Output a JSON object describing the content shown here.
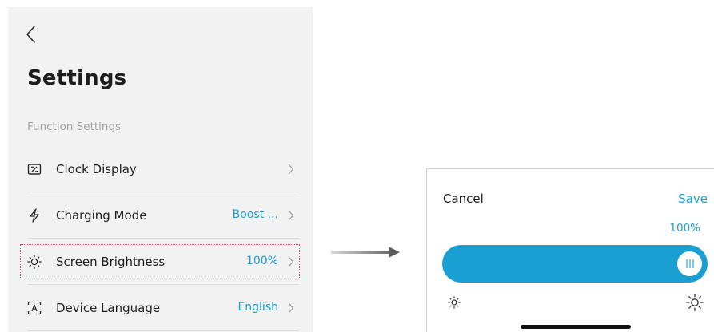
{
  "settings": {
    "title": "Settings",
    "section_label": "Function Settings",
    "items": [
      {
        "icon": "clock-display-icon",
        "label": "Clock Display",
        "value": ""
      },
      {
        "icon": "lightning-icon",
        "label": "Charging Mode",
        "value": "Boost ..."
      },
      {
        "icon": "sun-icon",
        "label": "Screen Brightness",
        "value": "100%"
      },
      {
        "icon": "language-icon",
        "label": "Device Language",
        "value": "English"
      }
    ]
  },
  "brightness_dialog": {
    "cancel_label": "Cancel",
    "save_label": "Save",
    "value_label": "100%",
    "level_fraction": 1.0
  },
  "colors": {
    "accent": "#1a9fd3",
    "panel_bg": "#f2f2f2",
    "highlight_outline": "#d6486c",
    "track": "#e6e6e6"
  }
}
